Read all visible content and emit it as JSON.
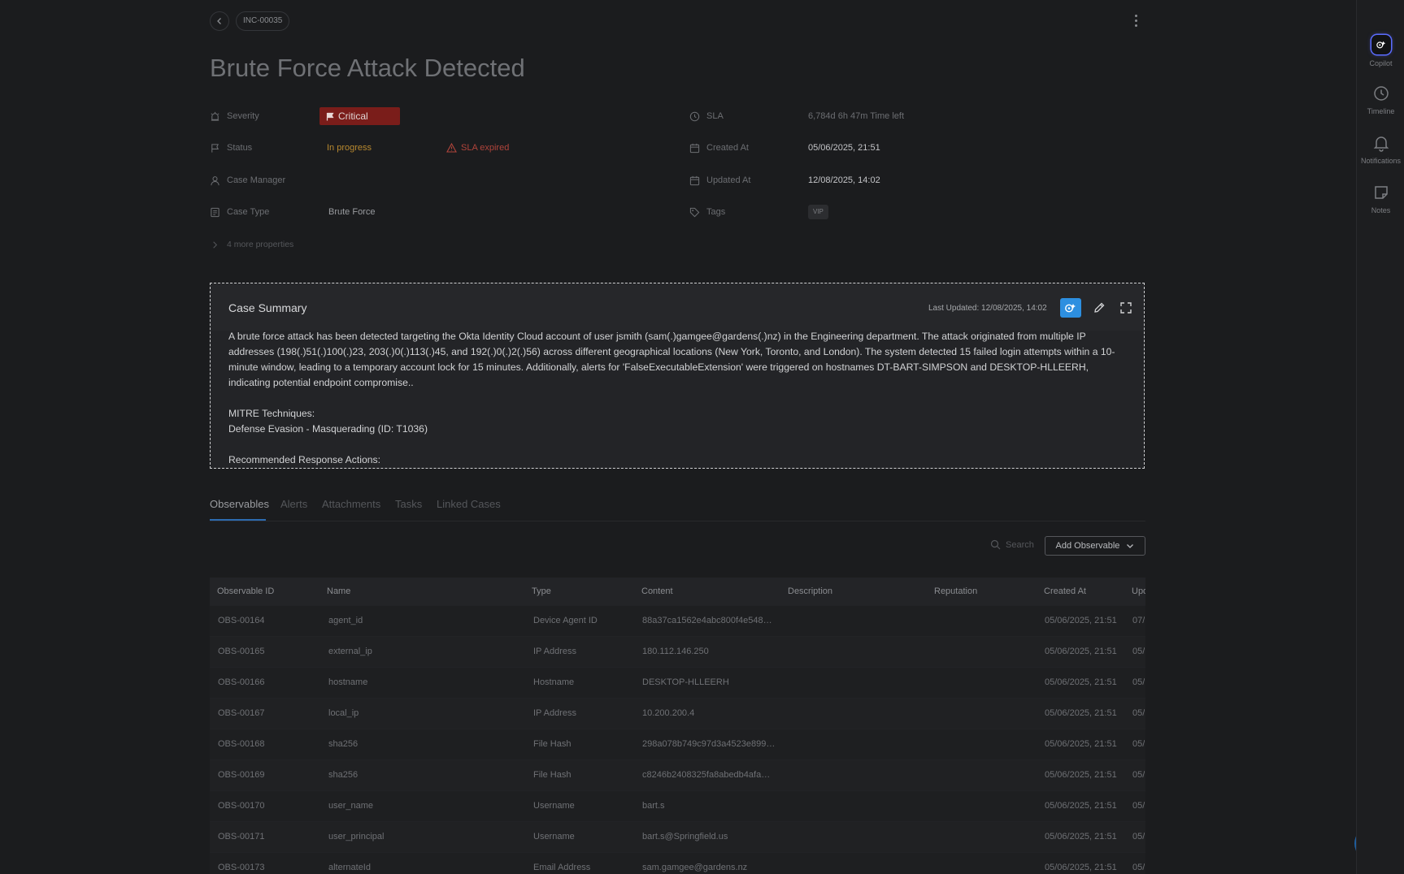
{
  "header": {
    "case_id": "INC-00035",
    "title": "Brute Force Attack Detected"
  },
  "properties": {
    "severity_label": "Severity",
    "severity_value": "Critical",
    "status_label": "Status",
    "status_value": "In progress",
    "sla_warning": "SLA expired",
    "case_manager_label": "Case Manager",
    "case_type_label": "Case Type",
    "case_type_value": "Brute Force",
    "more_properties": "4 more properties",
    "sla_label": "SLA",
    "sla_value": "6,784d 6h 47m  Time left",
    "created_label": "Created At",
    "created_value": "05/06/2025, 21:51",
    "updated_label": "Updated At",
    "updated_value": "12/08/2025, 14:02",
    "tags_label": "Tags",
    "tag": "VIP"
  },
  "summary": {
    "title": "Case Summary",
    "last_updated": "Last Updated: 12/08/2025, 14:02",
    "paragraph1": "A brute force attack has been detected targeting the Okta Identity Cloud account of user jsmith (sam(.)gamgee@gardens(.)nz) in the Engineering department. The attack originated from multiple IP addresses (198(.)51(.)100(.)23, 203(.)0(.)113(.)45, and 192(.)0(.)2(.)56) across different geographical locations (New York, Toronto, and London). The system detected 15 failed login attempts within a 10-minute window, leading to a temporary account lock for 15 minutes. Additionally, alerts for 'FalseExecutableExtension' were triggered on hostnames DT-BART-SIMPSON and DESKTOP-HLLEERH, indicating potential endpoint compromise..",
    "mitre_heading": "MITRE Techniques:",
    "mitre_item": "Defense Evasion - Masquerading (ID: T1036)",
    "actions_heading": "Recommended Response Actions:"
  },
  "tabs": [
    "Observables",
    "Alerts",
    "Attachments",
    "Tasks",
    "Linked Cases"
  ],
  "toolbar": {
    "search_placeholder": "Search",
    "add_label": "Add Observable"
  },
  "table": {
    "columns": [
      "Observable ID",
      "Name",
      "Type",
      "Content",
      "Description",
      "Reputation",
      "Created At",
      "Upd"
    ],
    "rows": [
      [
        "OBS-00164",
        "agent_id",
        "Device Agent ID",
        "88a37ca1562e4abc800f4e548…",
        "",
        "",
        "05/06/2025, 21:51",
        "07/"
      ],
      [
        "OBS-00165",
        "external_ip",
        "IP Address",
        "180.112.146.250",
        "",
        "",
        "05/06/2025, 21:51",
        "05/"
      ],
      [
        "OBS-00166",
        "hostname",
        "Hostname",
        "DESKTOP-HLLEERH",
        "",
        "",
        "05/06/2025, 21:51",
        "05/"
      ],
      [
        "OBS-00167",
        "local_ip",
        "IP Address",
        "10.200.200.4",
        "",
        "",
        "05/06/2025, 21:51",
        "05/"
      ],
      [
        "OBS-00168",
        "sha256",
        "File Hash",
        "298a078b749c97d3a4523e899…",
        "",
        "",
        "05/06/2025, 21:51",
        "05/"
      ],
      [
        "OBS-00169",
        "sha256",
        "File Hash",
        "c8246b2408325fa8abedb4afa…",
        "",
        "",
        "05/06/2025, 21:51",
        "05/"
      ],
      [
        "OBS-00170",
        "user_name",
        "Username",
        "bart.s",
        "",
        "",
        "05/06/2025, 21:51",
        "05/"
      ],
      [
        "OBS-00171",
        "user_principal",
        "Username",
        "bart.s@Springfield.us",
        "",
        "",
        "05/06/2025, 21:51",
        "05/"
      ],
      [
        "OBS-00173",
        "alternateId",
        "Email Address",
        "sam.gamgee@gardens.nz",
        "",
        "",
        "05/06/2025, 21:51",
        "05/"
      ]
    ]
  },
  "rail": {
    "copilot": "Copilot",
    "timeline": "Timeline",
    "notifications": "Notifications",
    "notes": "Notes"
  },
  "colors": {
    "critical_badge": "#7a1d1a",
    "status_in_progress": "#b8892f",
    "sla_expired": "#b0443b",
    "accent_blue": "#2d8fe0"
  }
}
